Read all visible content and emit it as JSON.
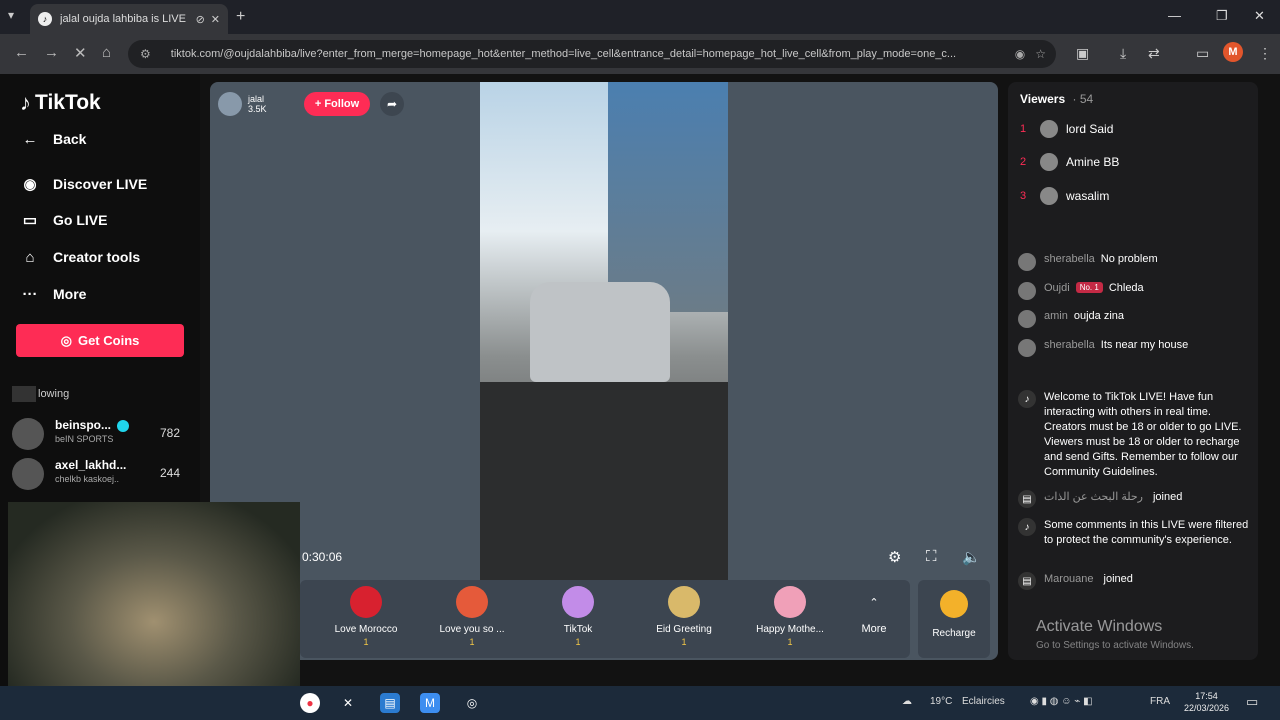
{
  "browser": {
    "tab_title": "jalal oujda lahbiba is LIVE",
    "url": "tiktok.com/@oujdalahbiba/live?enter_from_merge=homepage_hot&enter_method=live_cell&entrance_detail=homepage_hot_live_cell&from_play_mode=one_c..."
  },
  "sidebar": {
    "logo": "TikTok",
    "back": "Back",
    "discover": "Discover LIVE",
    "golive": "Go LIVE",
    "creator": "Creator tools",
    "more": "More",
    "getcoins": "Get Coins",
    "following": "lowing",
    "accounts": [
      {
        "name": "beinspo...",
        "sub": "beIN SPORTS",
        "count": "782"
      },
      {
        "name": "axel_lakhd...",
        "sub": "chelkb kaskoej..",
        "count": "244"
      }
    ]
  },
  "player": {
    "host_name": "jalal",
    "host_likes": "3.5K",
    "follow": "+ Follow",
    "timer": "0:30:06"
  },
  "gifts": {
    "items": [
      {
        "name": "Love Morocco",
        "price": "1",
        "color": "#d8212f"
      },
      {
        "name": "Love you so ...",
        "price": "1",
        "color": "#e55a3a"
      },
      {
        "name": "TikTok",
        "price": "1",
        "color": "#c28ce8"
      },
      {
        "name": "Eid Greeting",
        "price": "1",
        "color": "#d9b96a"
      },
      {
        "name": "Happy Mothe...",
        "price": "1",
        "color": "#f0a0b8"
      }
    ],
    "more": "More",
    "recharge": "Recharge"
  },
  "viewers": {
    "title": "Viewers",
    "count": "· 54",
    "top": [
      {
        "rank": "1",
        "name": "lord Said"
      },
      {
        "rank": "2",
        "name": "Amine BB"
      },
      {
        "rank": "3",
        "name": "wasalim"
      }
    ]
  },
  "comments": [
    {
      "user": "sherabella",
      "text": "No problem"
    },
    {
      "user": "Oujdi",
      "badge": "No. 1",
      "text": "Chleda"
    },
    {
      "user": "amin",
      "text": "oujda zina"
    },
    {
      "user": "sherabella",
      "text": "Its near my house"
    }
  ],
  "system": {
    "welcome": "Welcome to TikTok LIVE! Have fun interacting with others in real time. Creators must be 18 or older to go LIVE. Viewers must be 18 or older to recharge and send Gifts. Remember to follow our Community Guidelines.",
    "joined_user": "رحلة البحث عن الذات",
    "joined": "joined",
    "filtered": "Some comments in this LIVE were filtered to protect the community's experience.",
    "joined2_user": "Marouane",
    "joined2": "joined"
  },
  "watermark": {
    "line1": "Activate Windows",
    "line2": "Go to Settings to activate Windows."
  },
  "taskbar": {
    "weather": "19°C",
    "cond": "Eclaircies",
    "lang": "FRA",
    "time": "17:54",
    "date": "22/03/2026"
  }
}
